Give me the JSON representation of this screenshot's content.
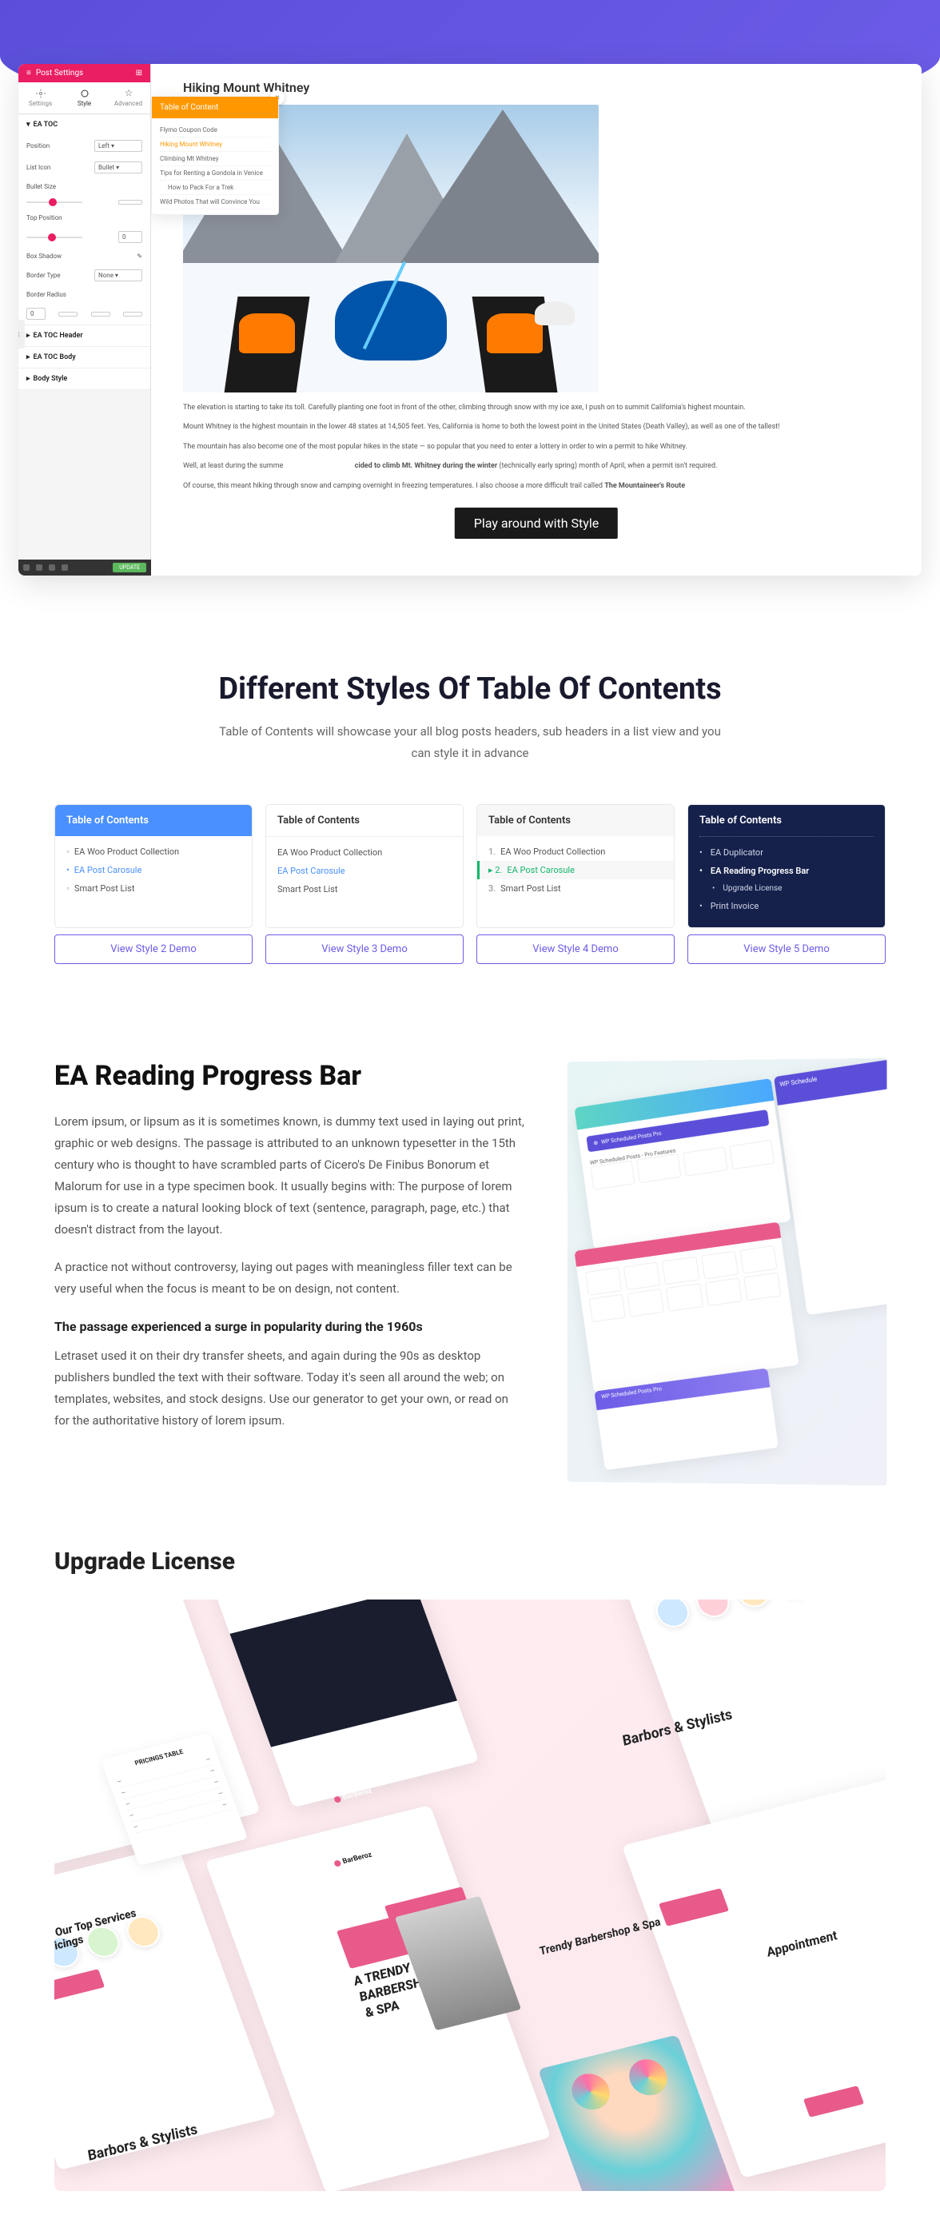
{
  "hero": {
    "panel_title": "Post Settings",
    "tabs": {
      "settings": "Settings",
      "style": "Style",
      "advanced": "Advanced"
    },
    "accordion": {
      "toc": "EA TOC",
      "header": "EA TOC Header",
      "body": "EA TOC Body",
      "style": "Body Style"
    },
    "fields": {
      "position": "Position",
      "position_val": "Left",
      "list_icon": "List Icon",
      "list_icon_val": "Bullet",
      "bullet_size": "Bullet Size",
      "top_position": "Top Position",
      "top_position_val": "0",
      "box_shadow": "Box Shadow",
      "border_type": "Border Type",
      "border_type_val": "None",
      "border_radius": "Border Radius",
      "border_radius_val": "0"
    },
    "update": "UPDATE",
    "blog_title": "Hiking Mount Whitney",
    "toc_title": "Table of Content",
    "toc_items": {
      "i1": "Flymo Coupon Code",
      "i2": "Hiking Mount Whitney",
      "i3": "Climbing Mt Whitney",
      "i4": "Tips for Renting a Gondola in Venice",
      "i5": "How to Pack For a Trek",
      "i6": "Wild Photos That will Convince You"
    },
    "para1": "The elevation is starting to take its toll. Carefully planting one foot in front of the other, climbing through snow with my ice axe, I push on to summit California's highest mountain.",
    "para2": "Mount Whitney is the highest mountain in the lower 48 states at 14,505 feet. Yes, California is home to both the lowest point in the United States (Death Valley), as well as one of the tallest!",
    "para3": "The mountain has also become one of the most popular hikes in the state — so popular that you need to enter a lottery in order to win a permit to hike Whitney.",
    "para4a": "Well, at least during the summe",
    "para4b": "cided to climb Mt. Whitney during the winter",
    "para4c": " (technically early spring) month of April, when a permit isn't required.",
    "para5a": "Of course, this meant hiking through snow and camping overnight in freezing temperatures. I also choose a more difficult trail called ",
    "para5b": "The Mountaineer's Route",
    "play_btn": "Play around with Style"
  },
  "section1": {
    "heading": "Different Styles Of Table Of Contents",
    "sub": "Table of Contents will showcase your all blog posts headers, sub headers in a list view and you can style it in advance"
  },
  "toc_cards": {
    "title": "Table of Contents",
    "s2": {
      "i1": "EA Woo Product Collection",
      "i2": "EA Post Carosule",
      "i3": "Smart Post List"
    },
    "s3": {
      "i1": "EA Woo Product Collection",
      "i2": "EA Post Carosule",
      "i3": "Smart Post List"
    },
    "s4": {
      "i1": "EA Woo Product Collection",
      "i2": "EA Post Carosule",
      "i3": "Smart Post List"
    },
    "s5": {
      "i1": "EA Duplicator",
      "i2": "EA Reading Progress Bar",
      "i3": "Upgrade License",
      "i4": "Print Invoice"
    }
  },
  "demo_buttons": {
    "b2": "View Style 2 Demo",
    "b3": "View Style 3 Demo",
    "b4": "View Style 4 Demo",
    "b5": "View Style 5 Demo"
  },
  "reading_progress": {
    "heading": "EA Reading Progress Bar",
    "p1": "Lorem ipsum, or lipsum as it is sometimes known, is dummy text used in laying out print, graphic or web designs. The passage is attributed to an unknown typesetter in the 15th century who is thought to have scrambled parts of Cicero's De Finibus Bonorum et Malorum for use in a type specimen book. It usually begins with: The purpose of lorem ipsum is to create a natural looking block of text (sentence, paragraph, page, etc.) that doesn't distract from the layout.",
    "p2": "A practice not without controversy, laying out pages with meaningless filler text can be very useful when the focus is meant to be on design, not content.",
    "sub": "The passage experienced a surge in popularity during the 1960s",
    "p3": "Letraset used it on their dry transfer sheets, and again during the 90s as desktop publishers bundled the text with their software. Today it's seen all around the web; on templates, websites, and stock designs. Use our generator to get your own, or read on for the authoritative history of lorem ipsum.",
    "mock": {
      "wpsched": "WP Scheduled Posts Pro",
      "features": "WP Scheduled Posts - Pro Features",
      "wpsched2": "WP Schedule"
    }
  },
  "upgrade": {
    "heading": "Upgrade License",
    "barbers": "Barbors & Stylists",
    "trendy1": "A TRENDY",
    "trendy2": "BARBERSHOP",
    "trendy3": "& SPA",
    "trendy_bottom": "Trendy Barbershop & Spa",
    "appointment": "Appointment",
    "services": "neck Our Top Services & Pricings",
    "barberoz": "BarBeroz",
    "price_title": "PRICINGS TABLE"
  }
}
